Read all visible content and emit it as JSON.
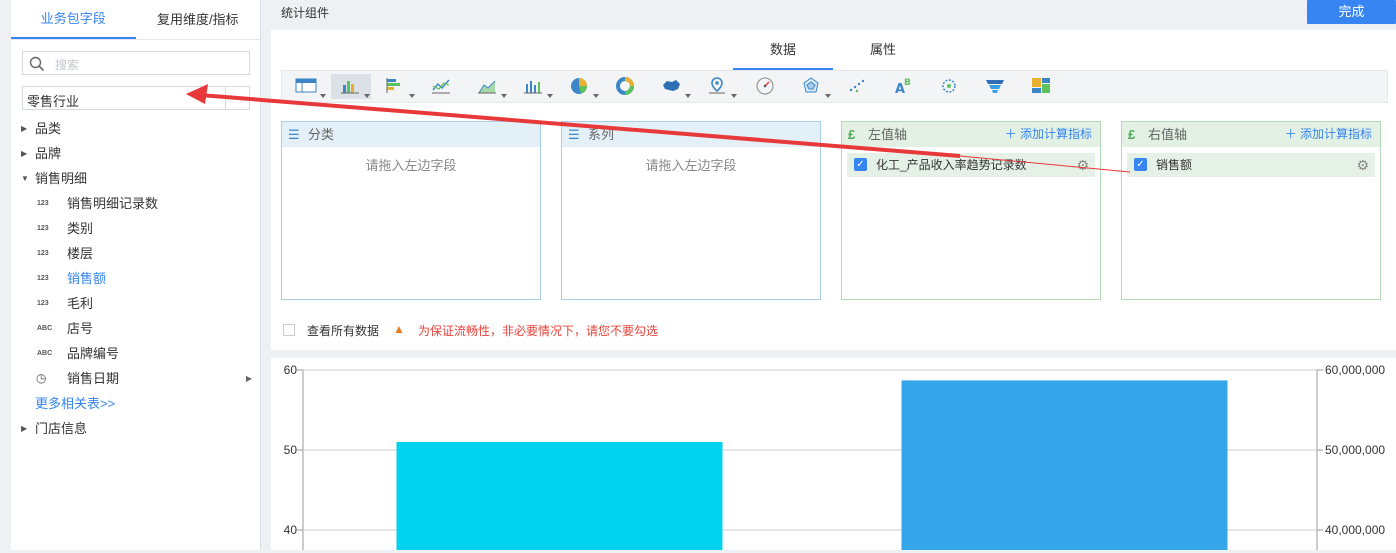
{
  "left_panel": {
    "tabs": [
      "业务包字段",
      "复用维度/指标"
    ],
    "search_placeholder": "搜索",
    "package_value": "零售行业",
    "tree": {
      "top1": "品类",
      "top2": "品牌",
      "group": "销售明细",
      "children": [
        {
          "type": "123",
          "label": "销售明细记录数"
        },
        {
          "type": "123",
          "label": "类别"
        },
        {
          "type": "123",
          "label": "楼层"
        },
        {
          "type": "123",
          "label": "销售额"
        },
        {
          "type": "123",
          "label": "毛利"
        },
        {
          "type": "ABC",
          "label": "店号"
        },
        {
          "type": "ABC",
          "label": "品牌编号"
        },
        {
          "type": "date",
          "label": "销售日期"
        }
      ],
      "more": "更多相关表>>",
      "last": "门店信息"
    }
  },
  "topbar": {
    "title": "统计组件",
    "done": "完成"
  },
  "config": {
    "tabs": [
      "数据",
      "属性"
    ],
    "boxes": [
      {
        "title": "分类",
        "placeholder": "请拖入左边字段"
      },
      {
        "title": "系列",
        "placeholder": "请拖入左边字段"
      },
      {
        "title": "左值轴",
        "add": "添加计算指标",
        "field": "化工_产品收入率趋势记录数"
      },
      {
        "title": "右值轴",
        "add": "添加计算指标",
        "field": "销售额"
      }
    ],
    "view_all": "查看所有数据",
    "warning": "为保证流畅性，非必要情况下，请您不要勾选"
  },
  "colors": {
    "accent": "#3685f2",
    "bar1": "#00d2ef",
    "bar2": "#36a6ea",
    "arrow": "#e8393a"
  },
  "chart_data": {
    "type": "bar",
    "categories": [
      "",
      ""
    ],
    "series": [
      {
        "values": [
          51,
          null
        ],
        "axis": "left"
      },
      {
        "values": [
          null,
          58700000
        ],
        "axis": "right"
      }
    ],
    "left_axis": {
      "ticks": [
        "60",
        "50",
        "40"
      ],
      "range": [
        40,
        60
      ]
    },
    "right_axis": {
      "ticks": [
        "60,000,000",
        "50,000,000",
        "40,000,000"
      ],
      "range": [
        40000000,
        60000000
      ]
    },
    "grid": true
  }
}
